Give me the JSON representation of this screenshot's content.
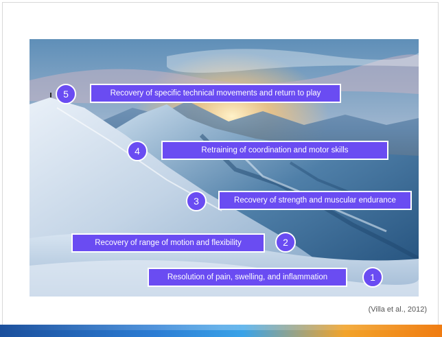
{
  "steps": [
    {
      "number": "5",
      "label": "Recovery of specific technical movements and return to play"
    },
    {
      "number": "4",
      "label": "Retraining of coordination and motor skills"
    },
    {
      "number": "3",
      "label": "Recovery of strength and muscular endurance"
    },
    {
      "number": "2",
      "label": "Recovery of range of motion and flexibility"
    },
    {
      "number": "1",
      "label": "Resolution of pain, swelling, and inflammation"
    }
  ],
  "citation": "(Villa et al., 2012)",
  "colors": {
    "accent": "#6a4cf2",
    "footer_start": "#1b4f9c",
    "footer_end": "#f07c12"
  }
}
